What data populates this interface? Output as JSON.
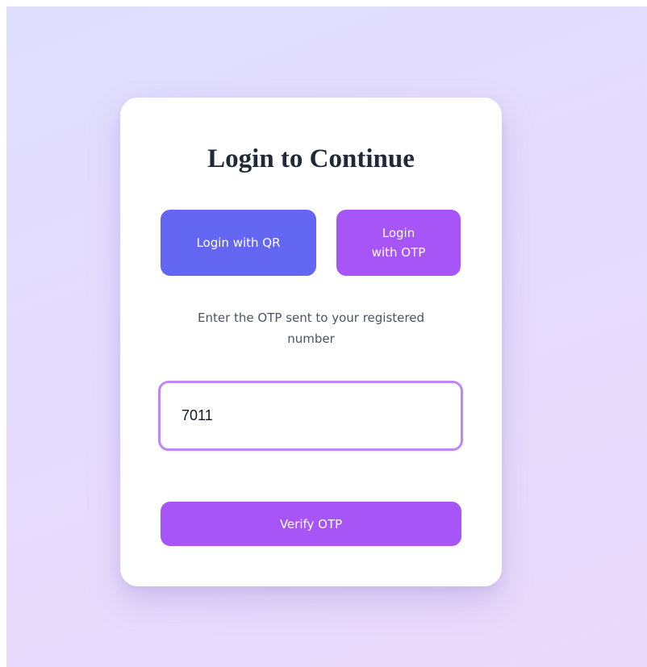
{
  "login": {
    "title": "Login to Continue",
    "qr_button_label": "Login with QR",
    "otp_button_label": "Login with OTP",
    "otp_hint": "Enter the OTP sent to your registered number",
    "otp_value": "7011",
    "verify_button_label": "Verify OTP"
  },
  "colors": {
    "background": "#e2ddfd",
    "card": "#ffffff",
    "qr_button": "#6366f1",
    "otp_button": "#a855f7",
    "input_border": "#c084fc",
    "verify_button": "#a855f7",
    "title_text": "#1f2937"
  }
}
